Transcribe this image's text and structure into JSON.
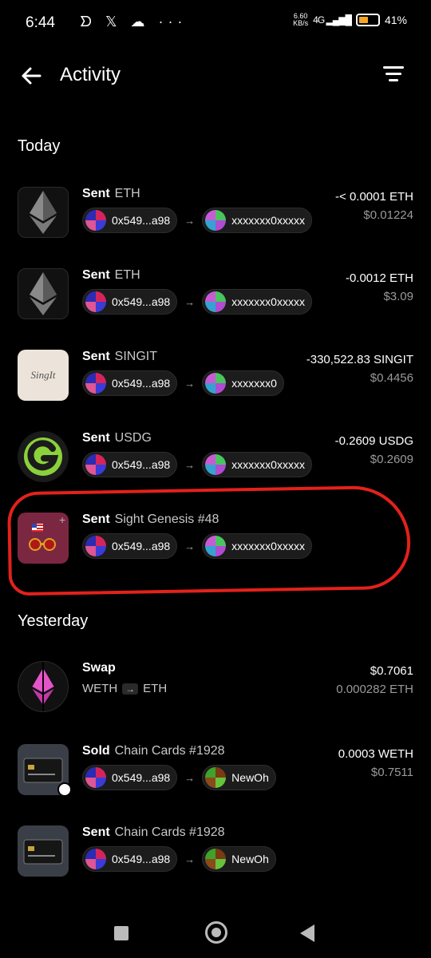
{
  "status_bar": {
    "time": "6:44",
    "left_icons": "ᗤ 𝕏 ☁ ···",
    "speed_value": "6.60",
    "speed_unit": "KB/s",
    "network": "4G",
    "battery_pct": "41%",
    "battery_level": 0.41
  },
  "header": {
    "title": "Activity"
  },
  "sections": {
    "today": "Today",
    "yesterday": "Yesterday"
  },
  "rows": [
    {
      "kind": "Sent",
      "asset": "ETH",
      "from": "0x549...a98",
      "to": "xxxxxxx0xxxxx",
      "primary": "-< 0.0001 ETH",
      "secondary": "$0.01224"
    },
    {
      "kind": "Sent",
      "asset": "ETH",
      "from": "0x549...a98",
      "to": "xxxxxxx0xxxxx",
      "primary": "-0.0012 ETH",
      "secondary": "$3.09"
    },
    {
      "kind": "Sent",
      "asset": "SINGIT",
      "from": "0x549...a98",
      "to": "xxxxxxx0",
      "primary": "-330,522.83 SINGIT",
      "secondary": "$0.4456"
    },
    {
      "kind": "Sent",
      "asset": "USDG",
      "from": "0x549...a98",
      "to": "xxxxxxx0xxxxx",
      "primary": "-0.2609 USDG",
      "secondary": "$0.2609"
    },
    {
      "kind": "Sent",
      "asset": "Sight Genesis #48",
      "from": "0x549...a98",
      "to": "xxxxxxx0xxxxx",
      "primary": "",
      "secondary": ""
    },
    {
      "kind": "Swap",
      "asset": "",
      "swap_from": "WETH",
      "swap_to": "ETH",
      "primary": "$0.7061",
      "secondary": "0.000282 ETH"
    },
    {
      "kind": "Sold",
      "asset": "Chain Cards #1928",
      "from": "0x549...a98",
      "to": "NewOh",
      "primary": "0.0003 WETH",
      "secondary": "$0.7511"
    },
    {
      "kind": "Sent",
      "asset": "Chain Cards #1928",
      "from": "0x549...a98",
      "to": "NewOh",
      "primary": "",
      "secondary": ""
    }
  ],
  "thumb_labels": {
    "singit": "SingIt"
  },
  "colors": {
    "highlight": "#e4211b",
    "background": "#000000"
  }
}
